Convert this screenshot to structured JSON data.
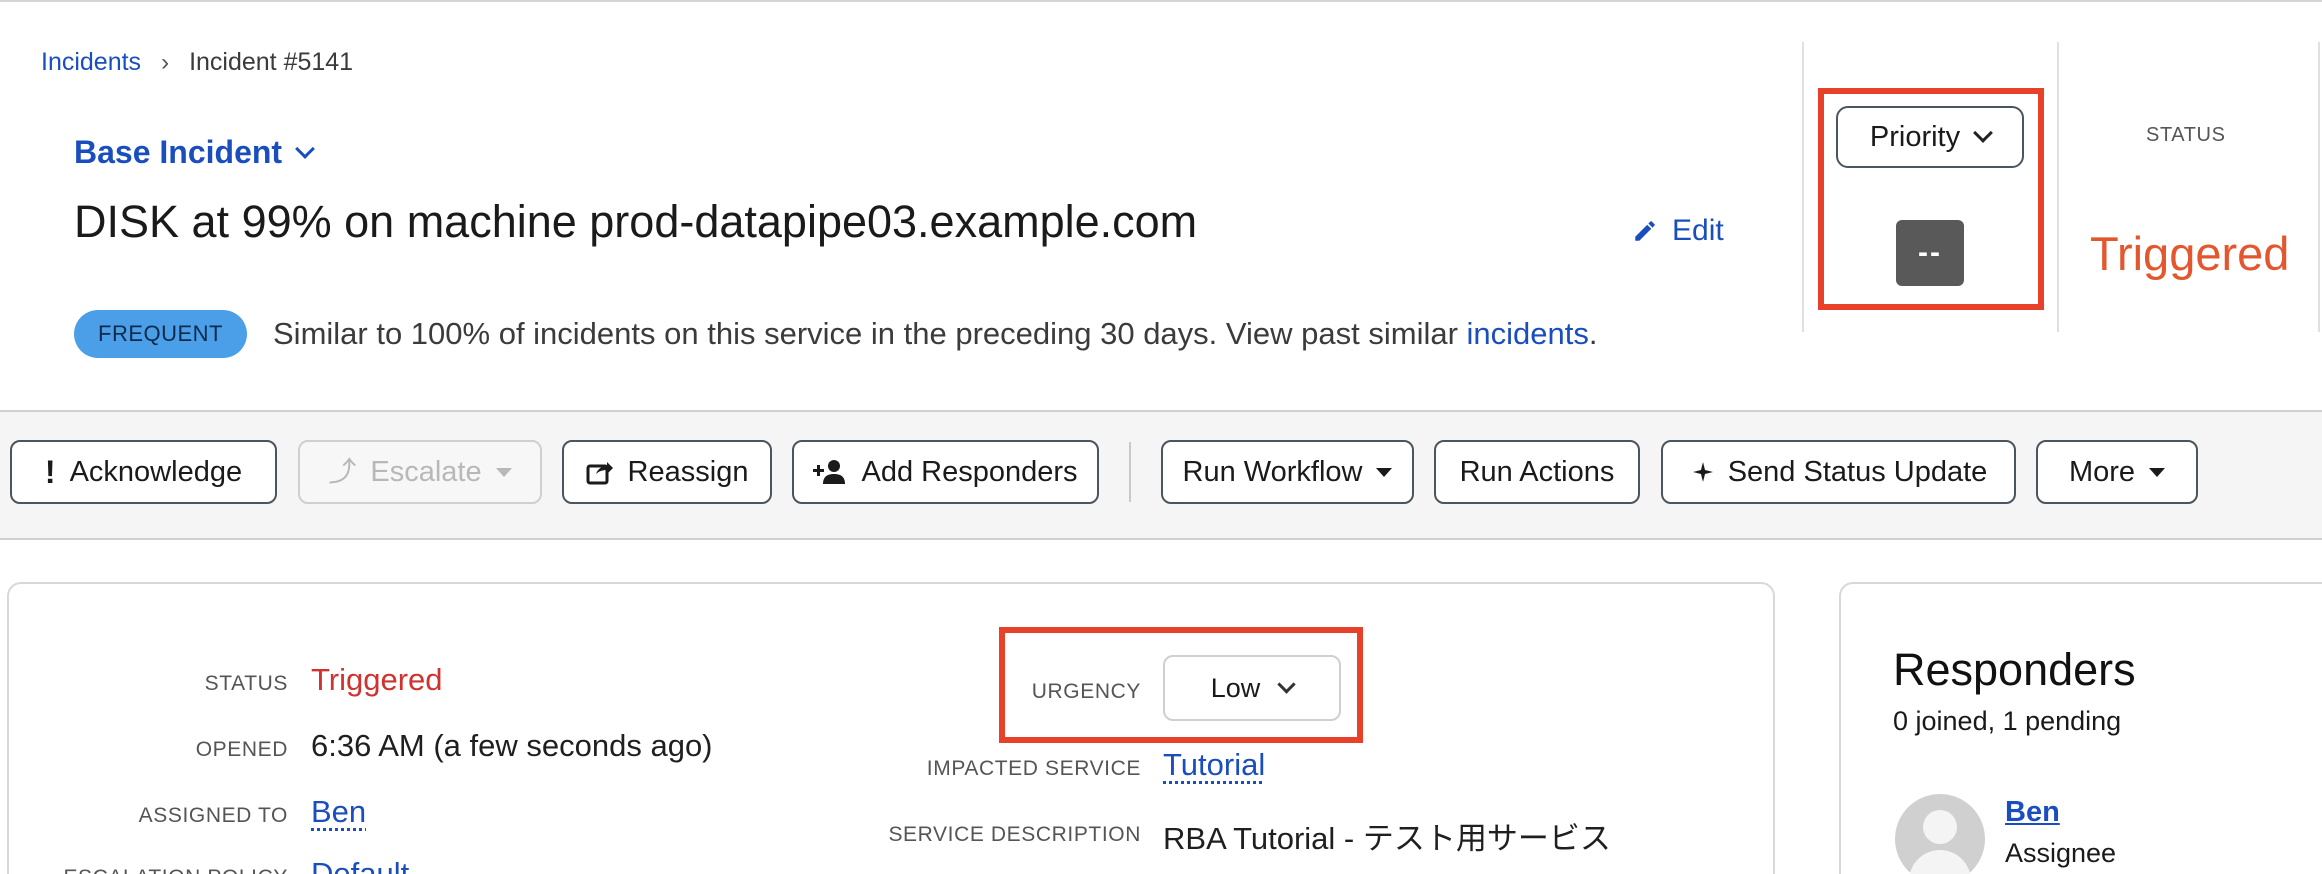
{
  "breadcrumb": {
    "root": "Incidents",
    "separator": "›",
    "current": "Incident #5141"
  },
  "incident": {
    "type_label": "Base Incident",
    "title": "DISK at 99% on machine prod-datapipe03.example.com",
    "edit_label": "Edit",
    "frequency_badge": "FREQUENT",
    "frequency_text": "Similar to 100% of incidents on this service in the preceding 30 days. View past similar ",
    "frequency_link": "incidents",
    "frequency_end": "."
  },
  "priority": {
    "button_label": "Priority",
    "value": "--"
  },
  "status_header": {
    "label": "STATUS",
    "value": "Triggered"
  },
  "toolbar": {
    "acknowledge": "Acknowledge",
    "escalate": "Escalate",
    "reassign": "Reassign",
    "add_responders": "Add Responders",
    "run_workflow": "Run Workflow",
    "run_actions": "Run Actions",
    "send_status_update": "Send Status Update",
    "more": "More"
  },
  "details": {
    "status_label": "STATUS",
    "status_value": "Triggered",
    "opened_label": "OPENED",
    "opened_value": "6:36 AM (a few seconds ago)",
    "assigned_label": "ASSIGNED TO",
    "assigned_value": "Ben",
    "escalation_label": "ESCALATION POLICY",
    "escalation_value": "Default",
    "urgency_label": "URGENCY",
    "urgency_value": "Low",
    "impacted_label": "IMPACTED SERVICE",
    "impacted_value": "Tutorial",
    "service_desc_label": "SERVICE DESCRIPTION",
    "service_desc_value": "RBA Tutorial - テスト用サービス"
  },
  "responders": {
    "title": "Responders",
    "summary": "0 joined, 1 pending",
    "items": [
      {
        "name": "Ben",
        "role": "Assignee"
      }
    ]
  },
  "colors": {
    "link": "#1a4ebf",
    "triggered": "#e4572e",
    "highlight_box": "#e8412a",
    "badge": "#4a9fe8"
  }
}
